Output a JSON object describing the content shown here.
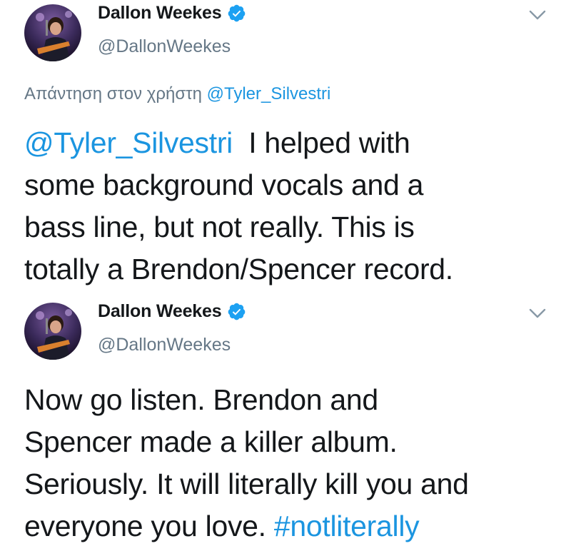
{
  "tweets": [
    {
      "author": {
        "display_name": "Dallon Weekes",
        "handle": "@DallonWeekes",
        "verified": true,
        "avatar_icon": "avatar-photo"
      },
      "reply_context": {
        "prefix": "Απάντηση στον χρήστη",
        "mention": "@Tyler_Silvestri"
      },
      "mention": "@Tyler_Silvestri",
      "text_lines": [
        "I helped with",
        "some background vocals and a",
        "bass line, but not really. This is",
        "totally a Brendon/Spencer record."
      ],
      "menu_icon": "chevron-down-icon"
    },
    {
      "author": {
        "display_name": "Dallon Weekes",
        "handle": "@DallonWeekes",
        "verified": true,
        "avatar_icon": "avatar-photo"
      },
      "text_lines": [
        "Now go listen. Brendon and",
        "Spencer made a killer album.",
        "Seriously. It will literally kill you and",
        "everyone you love."
      ],
      "hashtag": "#notliterally",
      "menu_icon": "chevron-down-icon"
    }
  ],
  "colors": {
    "link": "#1b95e0",
    "secondary_text": "#657786",
    "primary_text": "#14171a",
    "verified_badge": "#1da1f2"
  }
}
